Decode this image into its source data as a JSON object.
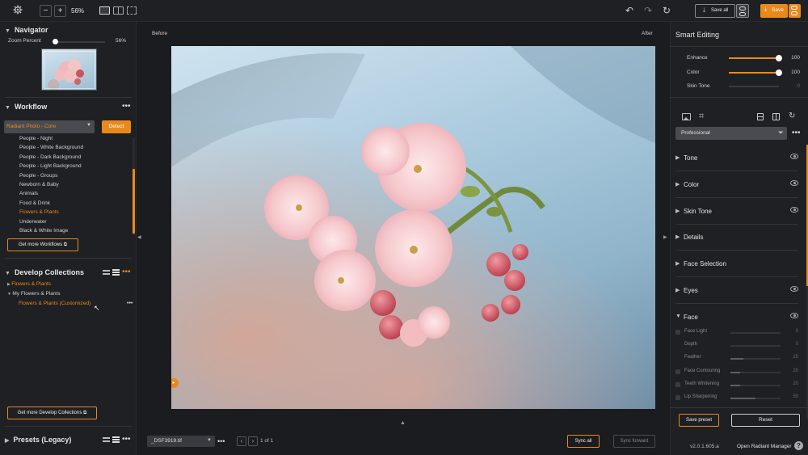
{
  "toolbar": {
    "zoom_minus": "−",
    "zoom_plus": "+",
    "zoom_value": "56%",
    "save_all_label": "Save all",
    "save_label": "Save"
  },
  "navigator": {
    "title": "Navigator",
    "zoom_label": "Zoom Percent",
    "zoom_value": "56%",
    "zoom_fraction": 0.0
  },
  "workflow": {
    "title": "Workflow",
    "selected": "Radiant Photo - Core",
    "detect_label": "Detect",
    "items": [
      {
        "label": "People - Night",
        "active": false
      },
      {
        "label": "People - White Background",
        "active": false
      },
      {
        "label": "People - Dark Background",
        "active": false
      },
      {
        "label": "People - Light Background",
        "active": false
      },
      {
        "label": "People - Groups",
        "active": false
      },
      {
        "label": "Newborn & Baby",
        "active": false
      },
      {
        "label": "Animals",
        "active": false
      },
      {
        "label": "Food & Drink",
        "active": false
      },
      {
        "label": "Flowers & Plants",
        "active": true
      },
      {
        "label": "Underwater",
        "active": false
      },
      {
        "label": "Black & White Image",
        "active": false
      }
    ],
    "more_label": "Get more Workflows"
  },
  "collections": {
    "title": "Develop Collections",
    "items": [
      {
        "label": "Flowers & Plants",
        "level": 0,
        "expanded": false,
        "color": "#e8891c"
      },
      {
        "label": "My Flowers & Plants",
        "level": 0,
        "expanded": true,
        "color": "#d0d0d0"
      },
      {
        "label": "Flowers & Plants (Customized)",
        "level": 1,
        "color": "#e8891c"
      }
    ],
    "more_label": "Get more Develop Collections"
  },
  "presets": {
    "title": "Presets (Legacy)"
  },
  "viewer": {
    "before_label": "Before",
    "after_label": "After",
    "file_name": "_DSF3919.tif",
    "page_info": "1 of 1",
    "sync_all_label": "Sync all",
    "sync_forward_label": "Sync forward"
  },
  "smart": {
    "title": "Smart Editing",
    "sliders": [
      {
        "label": "Enhance",
        "value": "100",
        "fraction": 1.0,
        "enabled": true
      },
      {
        "label": "Color",
        "value": "100",
        "fraction": 1.0,
        "enabled": true
      },
      {
        "label": "Skin Tone",
        "value": "0",
        "fraction": 0.0,
        "enabled": false
      }
    ],
    "preset_select": "Professional",
    "panels": [
      "Tone",
      "Color",
      "Skin Tone",
      "Details",
      "Face Selection",
      "Eyes",
      "Face"
    ],
    "face_sliders": [
      {
        "label": "Face Light",
        "value": "0",
        "fraction": 0.0,
        "checkbox": true
      },
      {
        "label": "Depth",
        "value": "0",
        "fraction": 0.0,
        "checkbox": false
      },
      {
        "label": "Feather",
        "value": "25",
        "fraction": 0.25,
        "checkbox": false
      },
      {
        "label": "Face Contouring",
        "value": "20",
        "fraction": 0.2,
        "checkbox": true
      },
      {
        "label": "Teeth Whitening",
        "value": "20",
        "fraction": 0.2,
        "checkbox": true
      },
      {
        "label": "Lip Sharpening",
        "value": "50",
        "fraction": 0.5,
        "checkbox": true
      }
    ],
    "save_preset_label": "Save preset",
    "reset_label": "Reset",
    "version": "v2.0.1.605.a",
    "open_manager_label": "Open Radiant Manager"
  },
  "colors": {
    "accent": "#e8891c",
    "panel_bg": "#1f2023",
    "canvas_bg": "#1b1c1f"
  }
}
